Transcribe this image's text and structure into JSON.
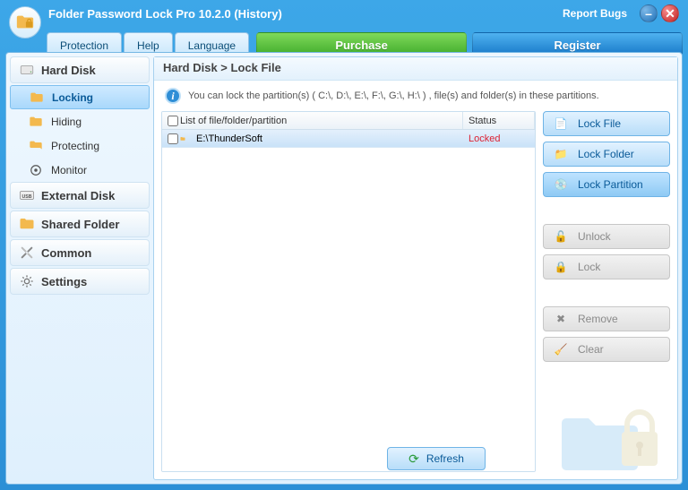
{
  "title": "Folder Password Lock Pro 10.2.0 (History)",
  "report_bugs": "Report Bugs",
  "menu": {
    "protection": "Protection",
    "help": "Help",
    "language": "Language"
  },
  "purchase": "Purchase",
  "register": "Register",
  "sidebar": {
    "hard_disk": "Hard Disk",
    "items": [
      {
        "label": "Locking"
      },
      {
        "label": "Hiding"
      },
      {
        "label": "Protecting"
      },
      {
        "label": "Monitor"
      }
    ],
    "external_disk": "External Disk",
    "shared_folder": "Shared Folder",
    "common": "Common",
    "settings": "Settings"
  },
  "breadcrumb": "Hard Disk > Lock File",
  "info_text": "You can lock the partition(s)  ( C:\\, D:\\, E:\\, F:\\, G:\\, H:\\ ) , file(s) and folder(s) in these partitions.",
  "list": {
    "header_path": "List of file/folder/partition",
    "header_status": "Status",
    "rows": [
      {
        "path": "E:\\ThunderSoft",
        "status": "Locked"
      }
    ]
  },
  "actions": {
    "lock_file": "Lock File",
    "lock_folder": "Lock Folder",
    "lock_partition": "Lock Partition",
    "unlock": "Unlock",
    "lock": "Lock",
    "remove": "Remove",
    "clear": "Clear"
  },
  "refresh": "Refresh"
}
